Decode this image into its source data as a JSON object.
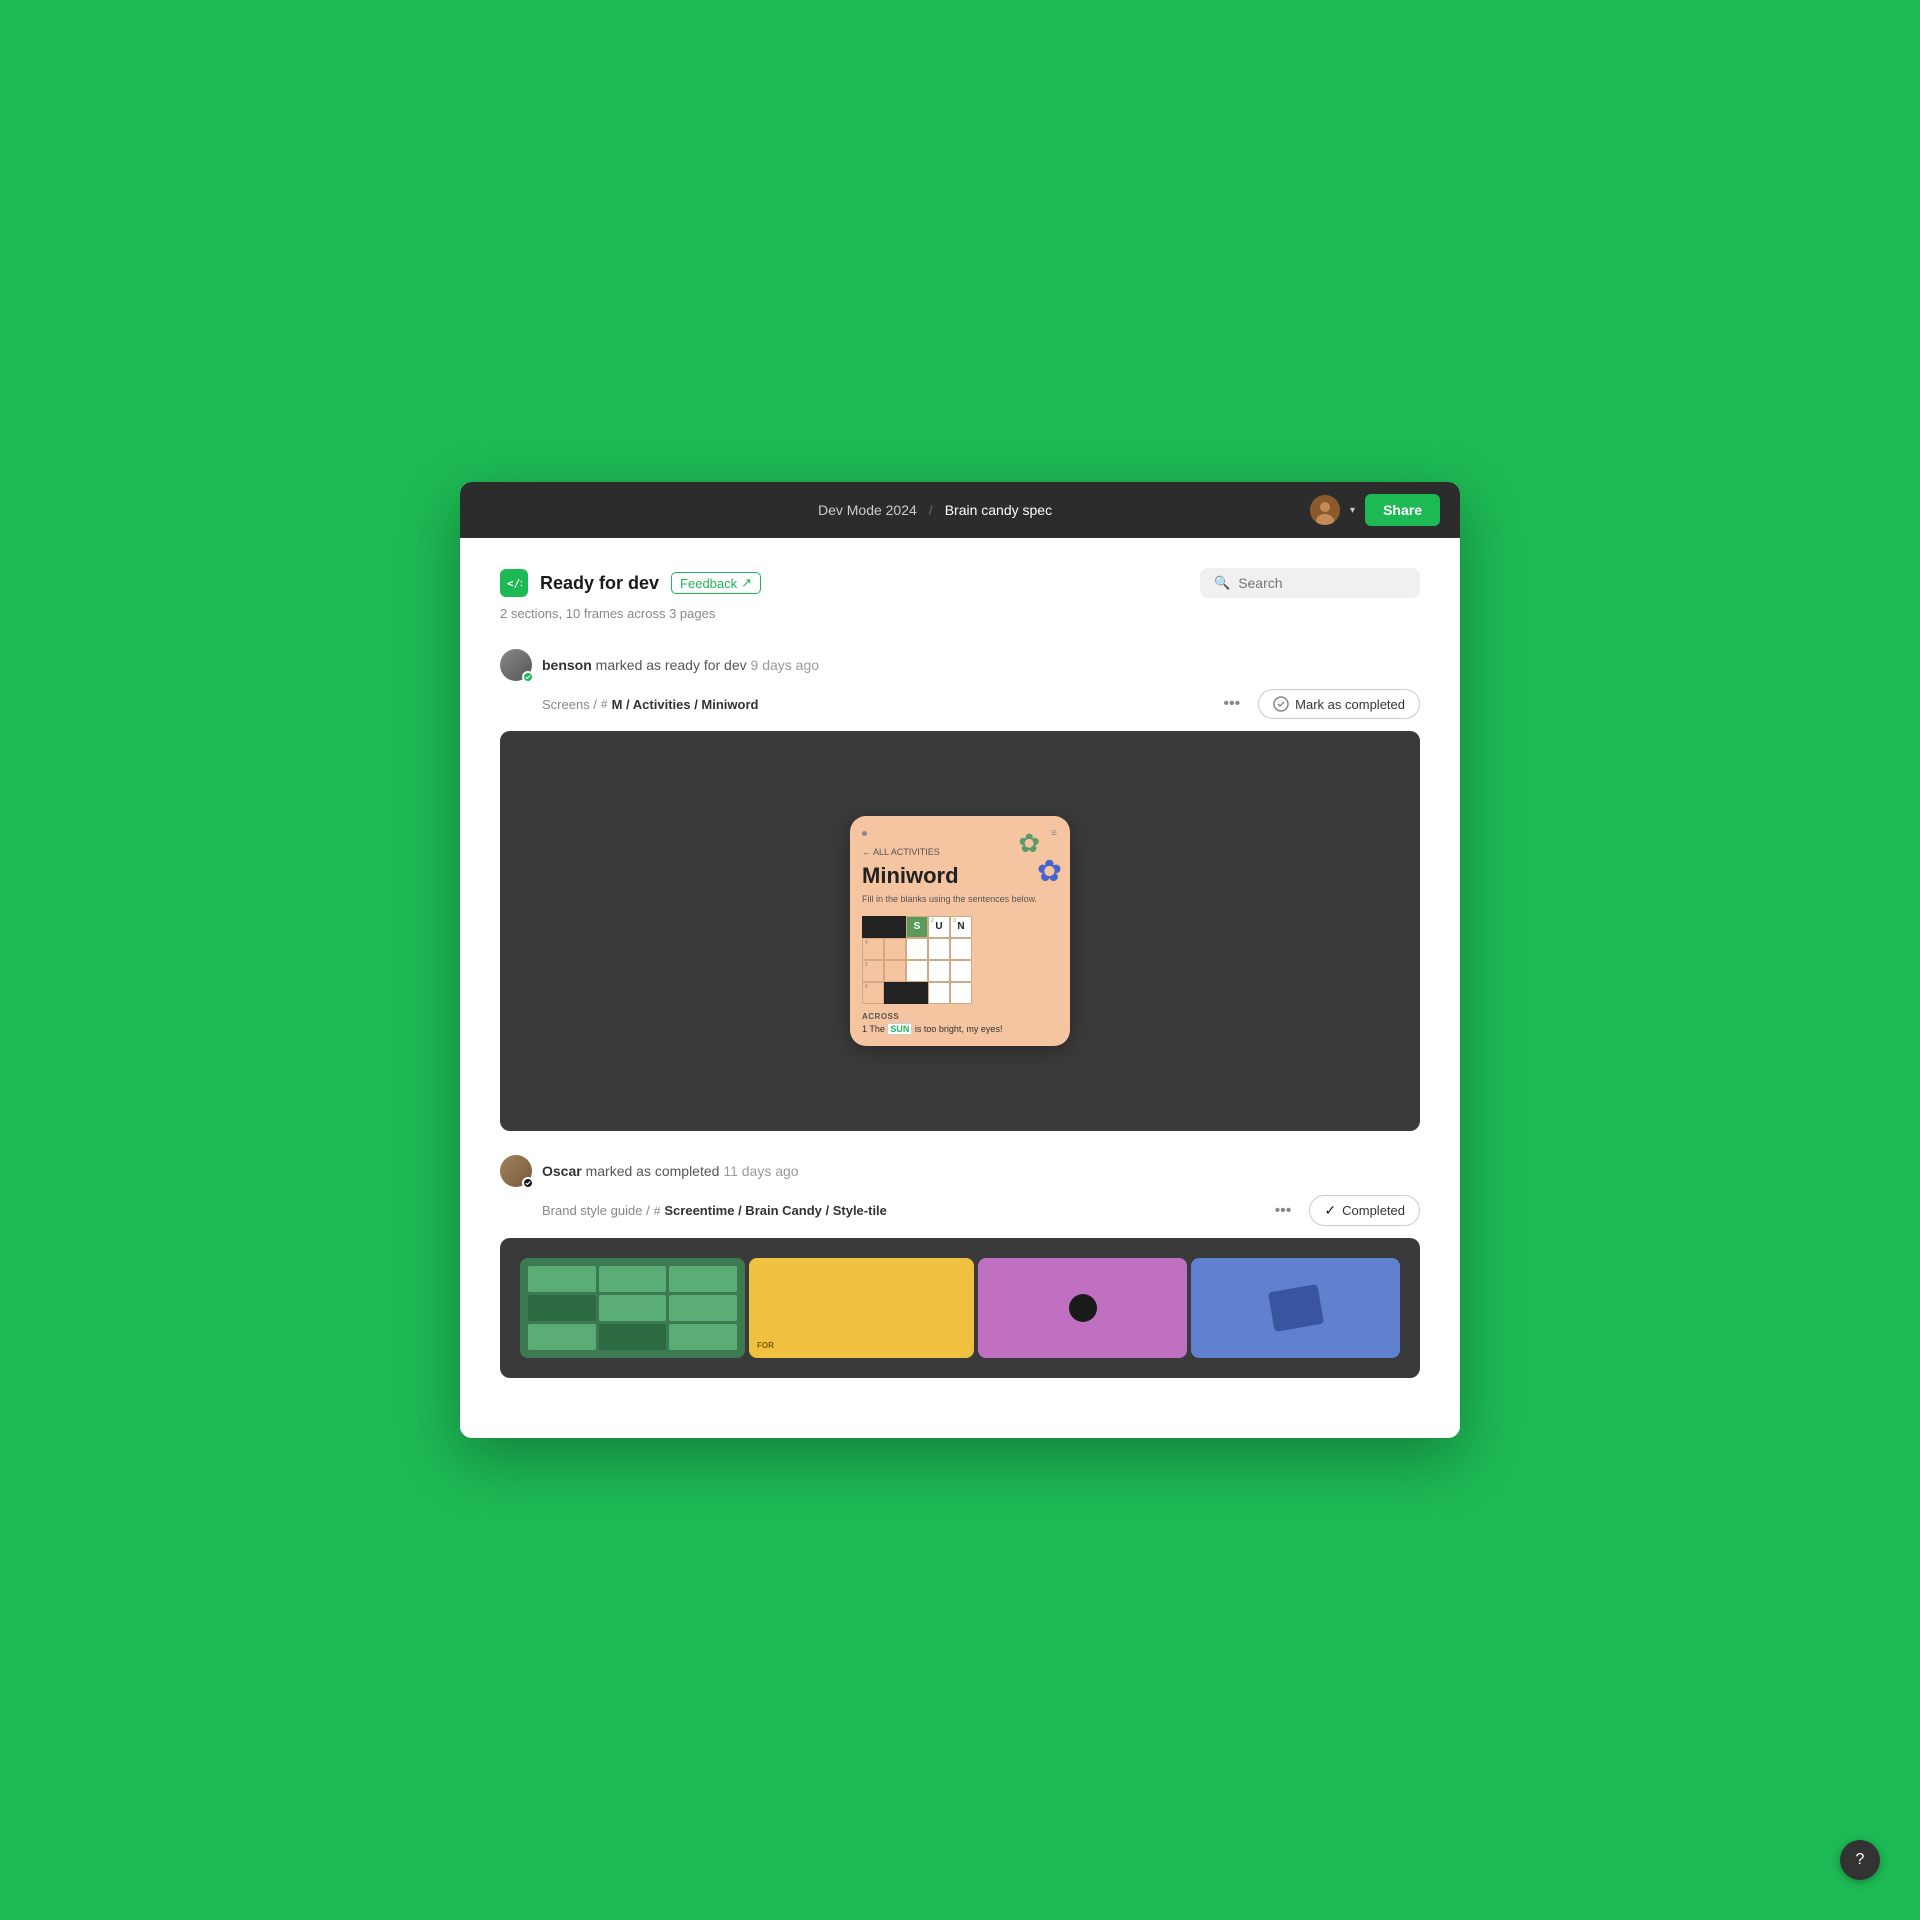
{
  "window": {
    "bg_color": "#1db954",
    "title_project": "Dev Mode 2024",
    "title_separator": "/",
    "title_page": "Brain candy spec",
    "share_label": "Share"
  },
  "header": {
    "ready_label": "Ready for dev",
    "feedback_label": "Feedback",
    "feedback_icon": "↗",
    "sections_info": "2 sections, 10 frames across 3 pages",
    "search_placeholder": "Search"
  },
  "activity": [
    {
      "user": "benson",
      "action": "marked as ready for dev",
      "time": "9 days ago",
      "path_prefix": "Screens /",
      "frame_name": "M / Activities / Miniword",
      "cta_label": "Mark as completed",
      "status": "pending"
    },
    {
      "user": "Oscar",
      "action": "marked as completed",
      "time": "11 days ago",
      "path_prefix": "Brand style guide /",
      "frame_name": "Screentime / Brain Candy / Style-tile",
      "cta_label": "Completed",
      "status": "completed"
    }
  ],
  "miniword": {
    "back_link": "← ALL ACTIVITIES",
    "title": "Miniword",
    "desc": "Fill in the blanks using the sentences below.",
    "across_label": "Across",
    "clue_number": "1",
    "clue_text_before": "The",
    "clue_highlight": "SUN",
    "clue_text_after": "is too bright, my eyes!"
  },
  "help": {
    "icon": "?"
  }
}
